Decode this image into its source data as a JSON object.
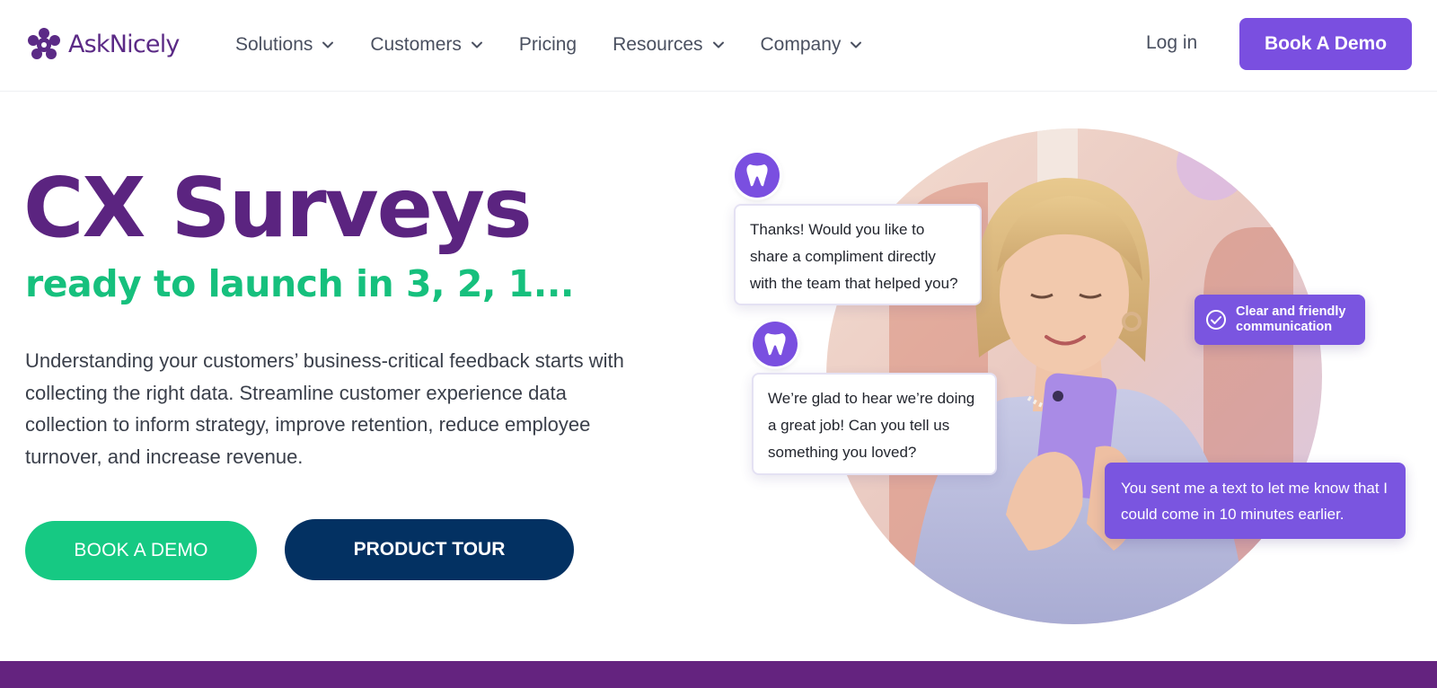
{
  "header": {
    "brand": "AskNicely",
    "nav": [
      {
        "label": "Solutions",
        "has_dropdown": true
      },
      {
        "label": "Customers",
        "has_dropdown": true
      },
      {
        "label": "Pricing",
        "has_dropdown": false
      },
      {
        "label": "Resources",
        "has_dropdown": true
      },
      {
        "label": "Company",
        "has_dropdown": true
      }
    ],
    "login_label": "Log in",
    "demo_label": "Book A Demo"
  },
  "hero": {
    "title": "CX Surveys",
    "subtitle": "ready to launch in 3, 2, 1...",
    "description": "Understanding your customers’ business-critical feedback starts with collecting the right data. Streamline customer experience data collection to inform strategy, improve retention, reduce employee turnover, and increase revenue.",
    "primary_cta": "BOOK A DEMO",
    "secondary_cta": "PRODUCT TOUR"
  },
  "illustration": {
    "bubble_1": "Thanks! Would you like to share a compliment directly with the team that helped you?",
    "bubble_2": "We’re glad to hear we’re doing a great job! Can you tell us something you loved?",
    "chip": "Clear and friendly communication",
    "reply": "You sent me a text to let me know that I could come in 10 minutes earlier.",
    "icons": [
      "tooth-icon",
      "tooth-icon",
      "check-circle-icon"
    ]
  },
  "colors": {
    "brand_purple": "#5b2480",
    "accent_purple": "#7a4fe0",
    "green": "#16c983",
    "navy": "#033162",
    "band": "#64237f"
  }
}
